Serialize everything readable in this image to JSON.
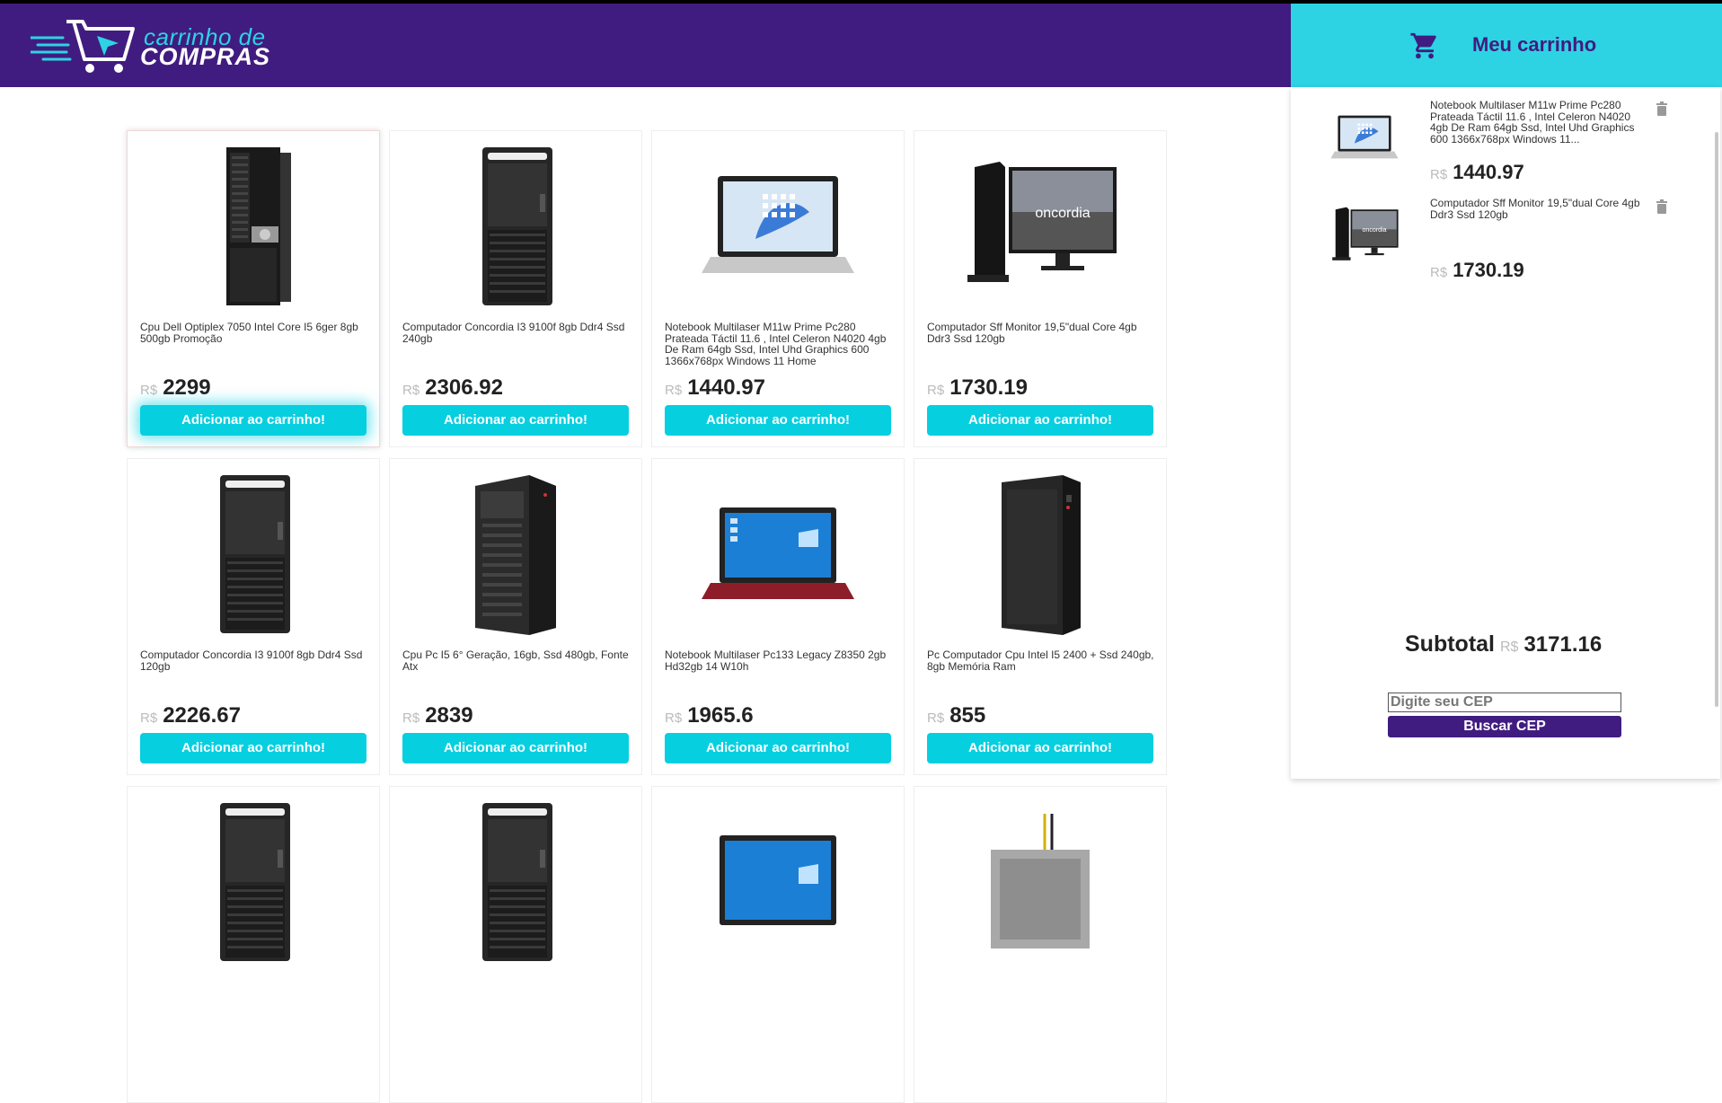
{
  "header": {
    "logo_line1": "carrinho de",
    "logo_line2": "COMPRAS"
  },
  "cart": {
    "title": "Meu carrinho",
    "items": [
      {
        "name": "Notebook Multilaser M11w Prime Pc280 Prateada Táctil 11.6 , Intel Celeron N4020 4gb De Ram 64gb Ssd, Intel Uhd Graphics 600 1366x768px Windows 11...",
        "currency": "R$",
        "price": "1440.97",
        "thumb": "laptop-silver"
      },
      {
        "name": "Computador Sff Monitor 19,5\"dual Core 4gb Ddr3 Ssd 120gb",
        "currency": "R$",
        "price": "1730.19",
        "thumb": "desktop-monitor"
      }
    ],
    "subtotal_label": "Subtotal",
    "subtotal_currency": "R$",
    "subtotal_value": "3171.16",
    "cep_placeholder": "Digite seu CEP",
    "cep_button": "Buscar CEP"
  },
  "button_label": "Adicionar ao carrinho!",
  "products": [
    {
      "name": "Cpu Dell Optiplex 7050 Intel Core I5 6ger 8gb 500gb Promoção",
      "currency": "R$",
      "price": "2299",
      "img": "tower-dell"
    },
    {
      "name": "Computador Concordia I3 9100f 8gb Ddr4 Ssd 240gb",
      "currency": "R$",
      "price": "2306.92",
      "img": "tower"
    },
    {
      "name": "Notebook Multilaser M11w Prime Pc280 Prateada Táctil 11.6 , Intel Celeron N4020 4gb De Ram 64gb Ssd, Intel Uhd Graphics 600 1366x768px Windows 11 Home",
      "currency": "R$",
      "price": "1440.97",
      "img": "laptop-silver"
    },
    {
      "name": "Computador Sff Monitor 19,5\"dual Core 4gb Ddr3 Ssd 120gb",
      "currency": "R$",
      "price": "1730.19",
      "img": "desktop-monitor"
    },
    {
      "name": "Computador Concordia I3 9100f 8gb Ddr4 Ssd 120gb",
      "currency": "R$",
      "price": "2226.67",
      "img": "tower"
    },
    {
      "name": "Cpu Pc I5 6° Geração, 16gb, Ssd 480gb, Fonte Atx",
      "currency": "R$",
      "price": "2839",
      "img": "tower-atx"
    },
    {
      "name": "Notebook Multilaser Pc133 Legacy Z8350 2gb Hd32gb 14 W10h",
      "currency": "R$",
      "price": "1965.6",
      "img": "laptop-red"
    },
    {
      "name": "Pc Computador Cpu Intel I5 2400 + Ssd 240gb, 8gb Memória Ram",
      "currency": "R$",
      "price": "855",
      "img": "tower-black"
    },
    {
      "name": "",
      "currency": "",
      "price": "",
      "img": "tower"
    },
    {
      "name": "",
      "currency": "",
      "price": "",
      "img": "tower"
    },
    {
      "name": "",
      "currency": "",
      "price": "",
      "img": "laptop-blue"
    },
    {
      "name": "",
      "currency": "",
      "price": "",
      "img": "psu"
    }
  ]
}
